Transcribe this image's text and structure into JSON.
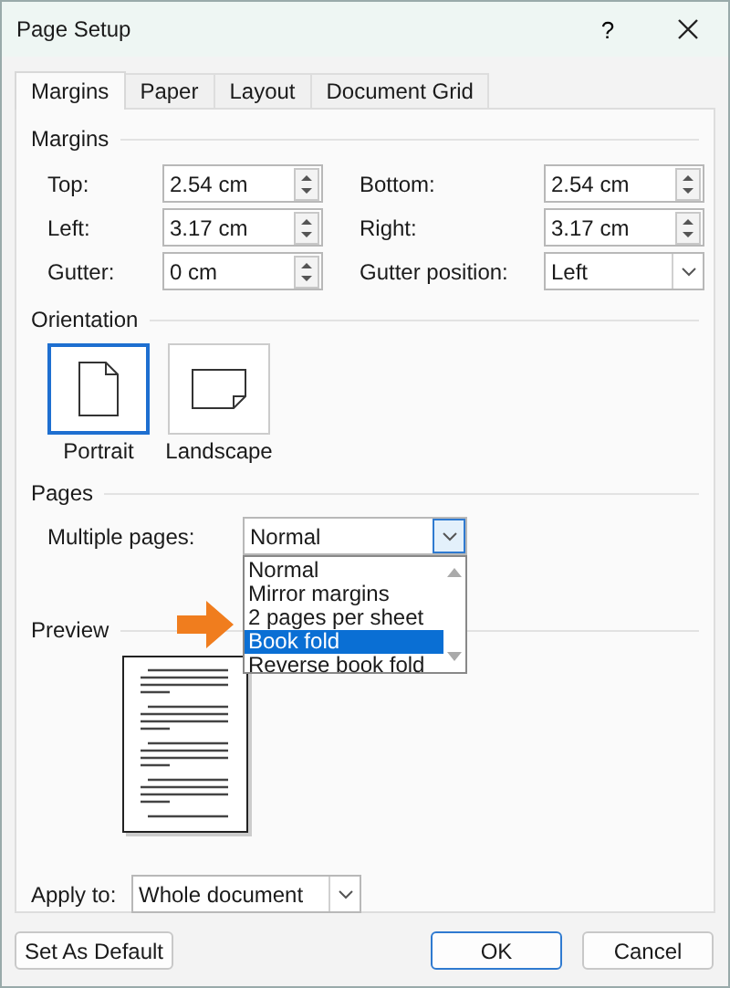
{
  "window": {
    "title": "Page Setup",
    "help": "?"
  },
  "tabs": [
    {
      "label": "Margins",
      "selected": true
    },
    {
      "label": "Paper",
      "selected": false
    },
    {
      "label": "Layout",
      "selected": false
    },
    {
      "label": "Document Grid",
      "selected": false
    }
  ],
  "margins": {
    "title": "Margins",
    "fields": [
      {
        "label": "Top:",
        "value": "2.54 cm",
        "kind": "spinner"
      },
      {
        "label": "Bottom:",
        "value": "2.54 cm",
        "kind": "spinner"
      },
      {
        "label": "Left:",
        "value": "3.17 cm",
        "kind": "spinner"
      },
      {
        "label": "Right:",
        "value": "3.17 cm",
        "kind": "spinner"
      },
      {
        "label": "Gutter:",
        "value": "0 cm",
        "kind": "spinner"
      },
      {
        "label": "Gutter position:",
        "value": "Left",
        "kind": "combo"
      }
    ]
  },
  "orientation": {
    "title": "Orientation",
    "options": [
      {
        "label": "Portrait",
        "kind": "portrait",
        "selected": true
      },
      {
        "label": "Landscape",
        "kind": "landscape",
        "selected": false
      }
    ]
  },
  "pages": {
    "title": "Pages",
    "multiple_pages": {
      "label": "Multiple pages:",
      "value": "Normal",
      "expanded": true,
      "options": [
        {
          "label": "Normal",
          "highlighted": false
        },
        {
          "label": "Mirror margins",
          "highlighted": false
        },
        {
          "label": "2 pages per sheet",
          "highlighted": false
        },
        {
          "label": "Book fold",
          "highlighted": true
        },
        {
          "label": "Reverse book fold",
          "highlighted": false
        }
      ]
    }
  },
  "preview": {
    "title": "Preview"
  },
  "apply_to": {
    "label": "Apply to:",
    "value": "Whole document"
  },
  "annotation": {
    "kind": "arrow"
  },
  "buttons": [
    {
      "label": "Set As Default",
      "kind": "normal"
    },
    {
      "label": "OK",
      "kind": "primary"
    },
    {
      "label": "Cancel",
      "kind": "normal"
    }
  ]
}
